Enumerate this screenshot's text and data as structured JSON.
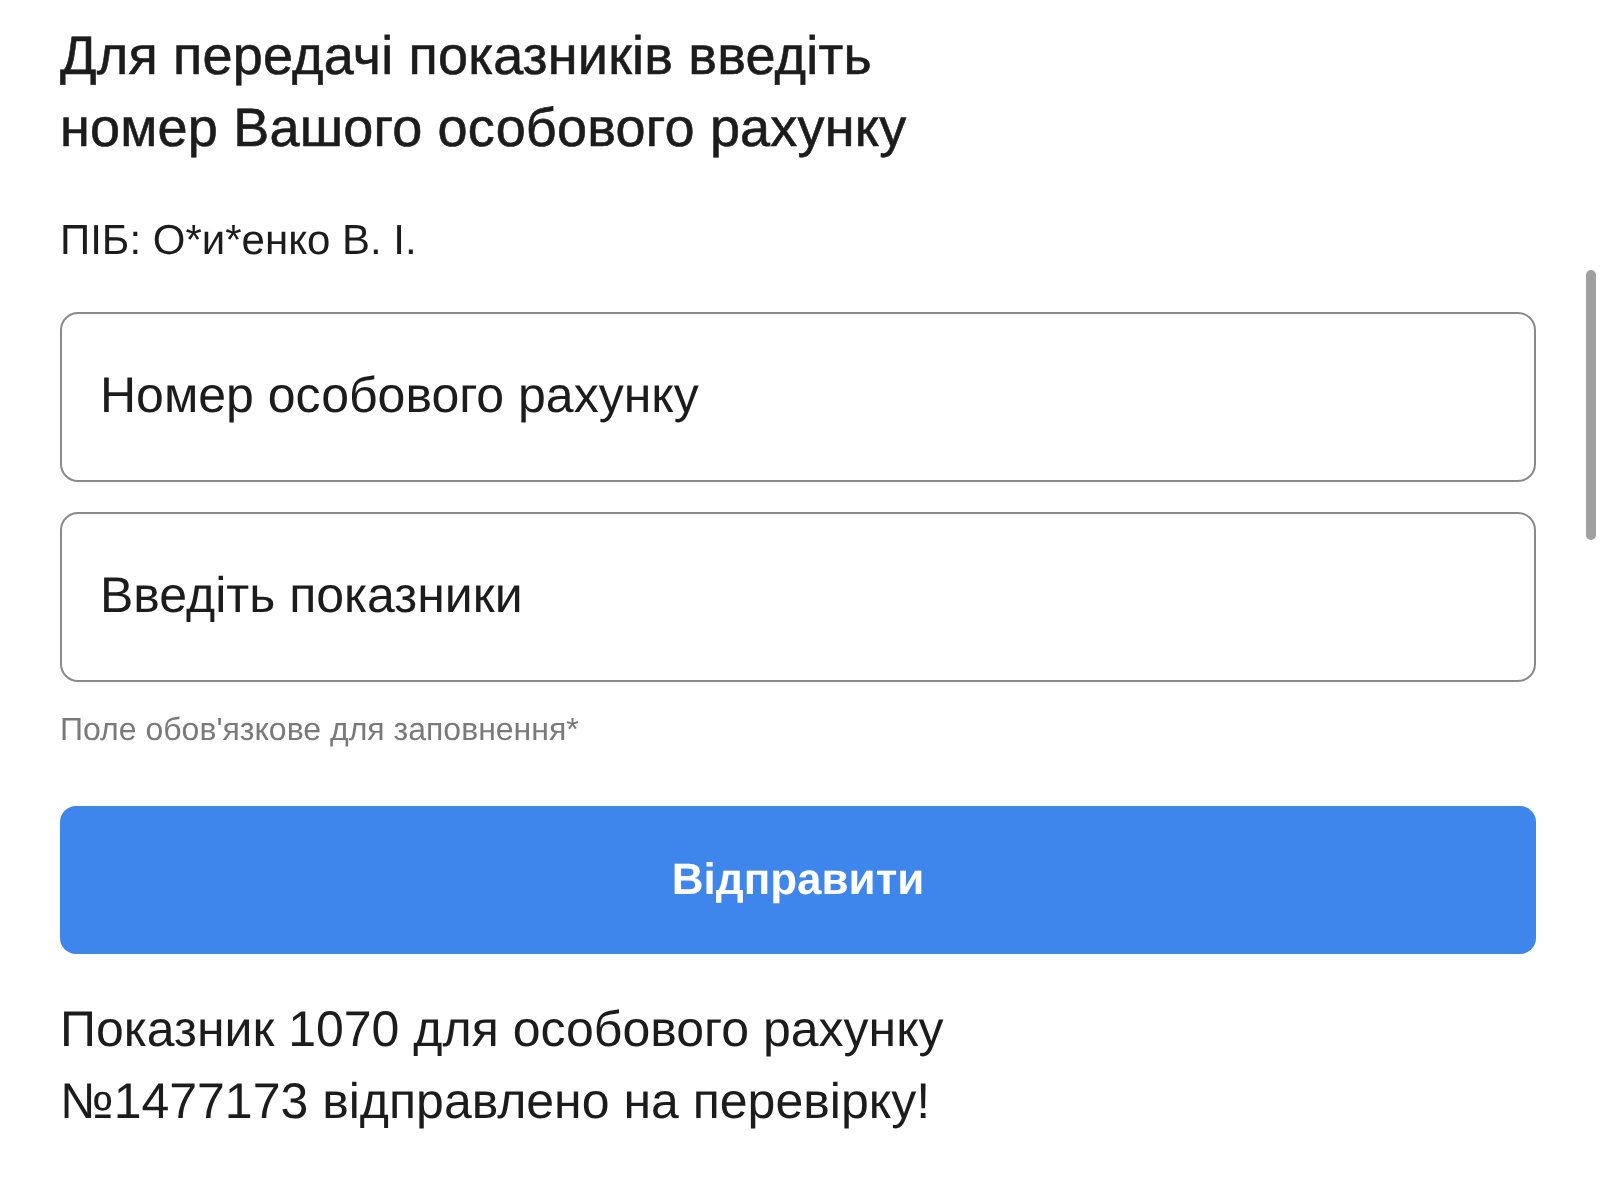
{
  "heading": "Для передачі показників введіть номер Вашого особового рахунку",
  "owner": "ПІБ: О*и*енко В. І.",
  "fields": [
    {
      "placeholder": "Номер особового рахунку"
    },
    {
      "placeholder": "Введіть показники"
    }
  ],
  "required_note": "Поле обов'язкове для заповнення*",
  "submit_button": "Відправити",
  "result_message": "Показник 1070 для особового рахунку №1477173 відправлено на перевірку!"
}
